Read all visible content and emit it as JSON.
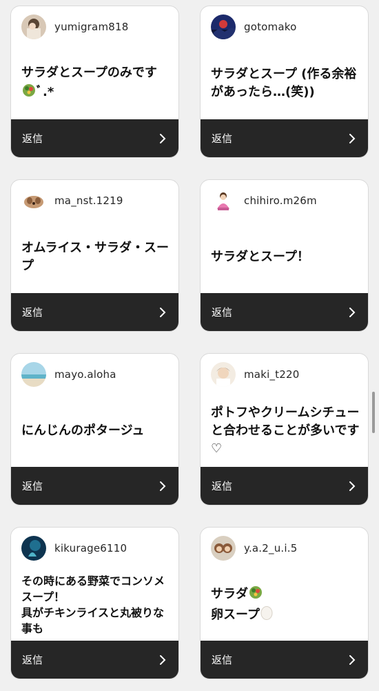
{
  "colors": {
    "card_bg": "#ffffff",
    "footer_bg": "#262626",
    "page_bg": "#f0f0f0",
    "text": "#111111"
  },
  "reply_label": "返信",
  "cards": [
    {
      "username": "yumigram818",
      "text_before": "サラダとスープのみです",
      "emoji": "salad-icon",
      "text_after": "ﾞ.*"
    },
    {
      "username": "gotomako",
      "text": "サラダとスープ (作る余裕があったら…(笑))"
    },
    {
      "username": "ma_nst.1219",
      "text": "オムライス・サラダ・スープ"
    },
    {
      "username": "chihiro.m26m",
      "text": "サラダとスープ！"
    },
    {
      "username": "mayo.aloha",
      "text": "にんじんのポタージュ"
    },
    {
      "username": "maki_t220",
      "text": "ポトフやクリームシチューと合わせることが多いです♡"
    },
    {
      "username": "kikurage6110",
      "line1": "その時にある野菜でコンソメスープ！",
      "line2": "具がチキンライスと丸被りな事も"
    },
    {
      "username": "y.a.2_u.i.5",
      "line1": "サラダ",
      "line1_emoji": "salad-icon",
      "line2": "卵スープ",
      "line2_emoji": "egg-icon"
    }
  ]
}
